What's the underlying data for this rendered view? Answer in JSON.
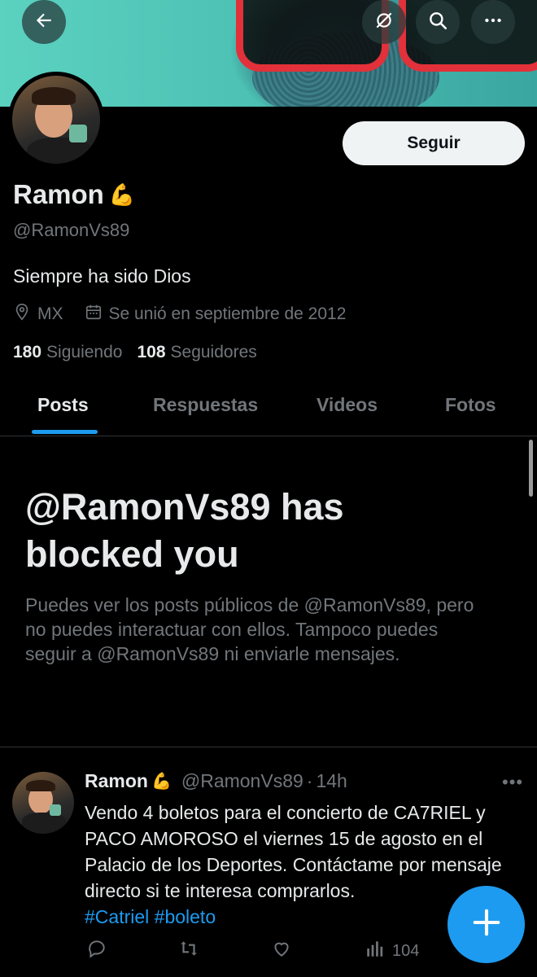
{
  "profile": {
    "name": "Ramon",
    "name_emoji": "💪",
    "handle": "@RamonVs89",
    "bio": "Siempre ha sido Dios",
    "location": "MX",
    "joined": "Se unió en septiembre de 2012",
    "following_count": "180",
    "following_label": "Siguiendo",
    "followers_count": "108",
    "followers_label": "Seguidores",
    "follow_button": "Seguir"
  },
  "header_icons": {
    "back": "back-arrow-icon",
    "grok": "slashed-circle-icon",
    "search": "search-icon",
    "more": "more-icon"
  },
  "tabs": [
    {
      "label": "Posts",
      "active": true
    },
    {
      "label": "Respuestas",
      "active": false
    },
    {
      "label": "Videos",
      "active": false
    },
    {
      "label": "Fotos",
      "active": false
    }
  ],
  "blocked": {
    "title": "@RamonVs89 has blocked you",
    "message": "Puedes ver los posts públicos de @RamonVs89, pero no puedes interactuar con ellos. Tampoco puedes seguir a @RamonVs89 ni enviarle mensajes."
  },
  "post": {
    "name": "Ramon",
    "name_emoji": "💪",
    "handle": "@RamonVs89",
    "separator": "·",
    "time": "14h",
    "more": "•••",
    "text": "Vendo 4 boletos para el concierto de CA7RIEL y PACO AMOROSO el viernes 15 de agosto en el Palacio de los Deportes. Contáctame por mensaje directo si te interesa comprarlos.",
    "hashtags": [
      "#Catriel",
      "#boleto"
    ],
    "views": "104"
  },
  "colors": {
    "accent": "#1d9bf0",
    "background": "#000000",
    "text": "#e7e9ea",
    "muted": "#71767b"
  }
}
